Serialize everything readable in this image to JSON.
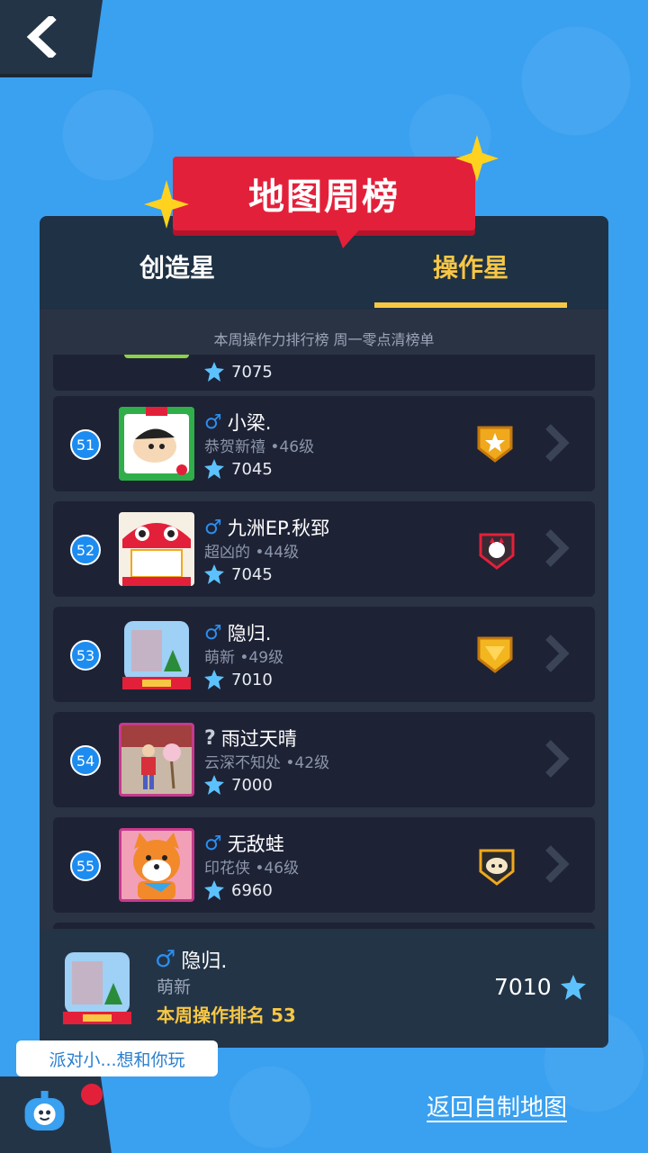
{
  "header": {
    "back_icon": "chevron-left-icon"
  },
  "banner": {
    "title": "地图周榜"
  },
  "tabs": {
    "create": "创造星",
    "operate": "操作星",
    "active": "operate"
  },
  "list": {
    "note": "本周操作力排行榜 周一零点清榜单",
    "partial_top_score": "7075",
    "rows": [
      {
        "rank": "51",
        "gender": "♂",
        "name": "小梁.",
        "sub": "恭贺新禧 •46级",
        "score": "7045",
        "badge": "gold-star-badge"
      },
      {
        "rank": "52",
        "gender": "♂",
        "name": "九洲EP.秋郅",
        "sub": "超凶的 •44级",
        "score": "7045",
        "badge": "red-cat-badge"
      },
      {
        "rank": "53",
        "gender": "♂",
        "name": "隐归.",
        "sub": "萌新 •49级",
        "score": "7010",
        "badge": "gold-badge"
      },
      {
        "rank": "54",
        "gender": "?",
        "name": "雨过天晴",
        "sub": "云深不知处 •42级",
        "score": "7000",
        "badge": ""
      },
      {
        "rank": "55",
        "gender": "♂",
        "name": "无敌蛙",
        "sub": "印花侠 •46级",
        "score": "6960",
        "badge": "sheep-badge"
      }
    ]
  },
  "me": {
    "gender": "♂",
    "name": "隐归.",
    "title": "萌新",
    "rank_text": "本周操作排名 53",
    "score": "7010"
  },
  "chat": {
    "bubble": "派对小...想和你玩"
  },
  "footer": {
    "return_link": "返回自制地图"
  },
  "colors": {
    "background": "#3aa0f0",
    "panel": "#1f3144",
    "accent": "#f7c744",
    "banner": "#e3203a"
  }
}
